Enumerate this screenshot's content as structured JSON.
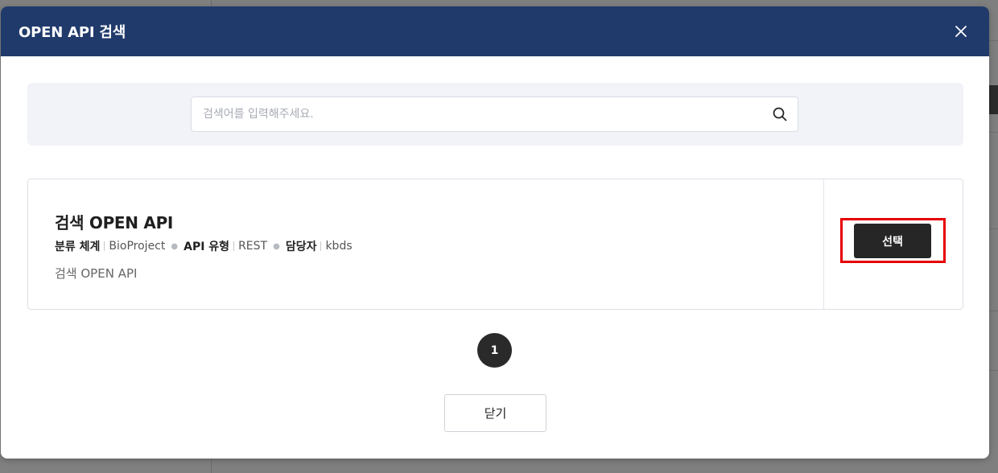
{
  "modal": {
    "title": "OPEN API 검색",
    "close_icon": "close-icon"
  },
  "search": {
    "placeholder": "검색어를 입력해주세요.",
    "value": "",
    "icon": "search-icon"
  },
  "results": [
    {
      "title": "검색 OPEN API",
      "meta": [
        {
          "label": "분류 체계",
          "value": "BioProject"
        },
        {
          "label": "API 유형",
          "value": "REST"
        },
        {
          "label": "담당자",
          "value": "kbds"
        }
      ],
      "description": "검색 OPEN API",
      "select_label": "선택"
    }
  ],
  "pagination": {
    "current_page": "1"
  },
  "footer": {
    "close_label": "닫기"
  },
  "colors": {
    "header_bg": "#203a6b",
    "primary_button": "#262626",
    "highlight": "#e60000"
  }
}
